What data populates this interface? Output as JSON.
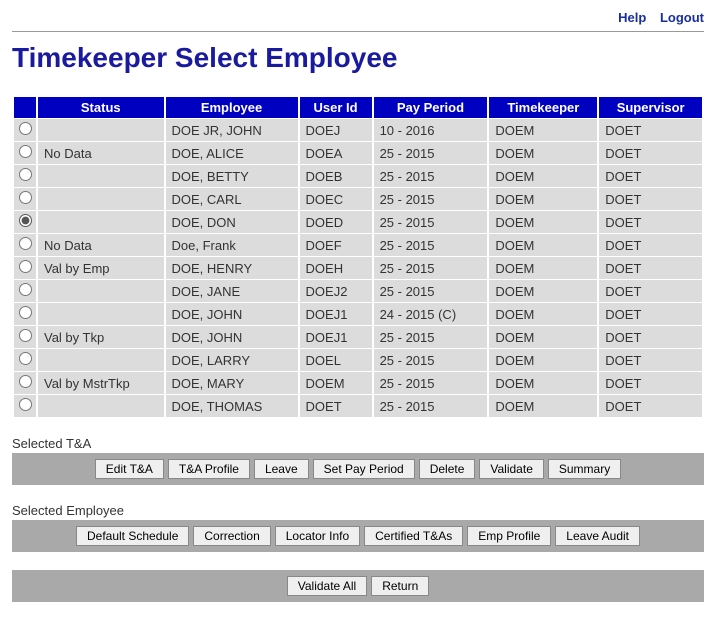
{
  "top_links": {
    "help": "Help",
    "logout": "Logout"
  },
  "page_title": "Timekeeper Select Employee",
  "columns": {
    "status": "Status",
    "employee": "Employee",
    "user_id": "User Id",
    "pay_period": "Pay Period",
    "timekeeper": "Timekeeper",
    "supervisor": "Supervisor"
  },
  "selected_index": 4,
  "rows": [
    {
      "status": "",
      "employee": "DOE JR, JOHN",
      "user_id": "DOEJ",
      "pay_period": "10 - 2016",
      "timekeeper": "DOEM",
      "supervisor": "DOET"
    },
    {
      "status": "No Data",
      "employee": "DOE, ALICE",
      "user_id": "DOEA",
      "pay_period": "25 - 2015",
      "timekeeper": "DOEM",
      "supervisor": "DOET"
    },
    {
      "status": "",
      "employee": "DOE, BETTY",
      "user_id": "DOEB",
      "pay_period": "25 - 2015",
      "timekeeper": "DOEM",
      "supervisor": "DOET"
    },
    {
      "status": "",
      "employee": "DOE, CARL",
      "user_id": "DOEC",
      "pay_period": "25 - 2015",
      "timekeeper": "DOEM",
      "supervisor": "DOET"
    },
    {
      "status": "",
      "employee": "DOE, DON",
      "user_id": "DOED",
      "pay_period": "25 - 2015",
      "timekeeper": "DOEM",
      "supervisor": "DOET"
    },
    {
      "status": "No Data",
      "employee": "Doe, Frank",
      "user_id": "DOEF",
      "pay_period": "25 - 2015",
      "timekeeper": "DOEM",
      "supervisor": "DOET"
    },
    {
      "status": "Val by Emp",
      "employee": "DOE, HENRY",
      "user_id": "DOEH",
      "pay_period": "25 - 2015",
      "timekeeper": "DOEM",
      "supervisor": "DOET"
    },
    {
      "status": "",
      "employee": "DOE, JANE",
      "user_id": "DOEJ2",
      "pay_period": "25 - 2015",
      "timekeeper": "DOEM",
      "supervisor": "DOET"
    },
    {
      "status": "",
      "employee": "DOE, JOHN",
      "user_id": "DOEJ1",
      "pay_period": "24 - 2015 (C)",
      "timekeeper": "DOEM",
      "supervisor": "DOET"
    },
    {
      "status": "Val by Tkp",
      "employee": "DOE, JOHN",
      "user_id": "DOEJ1",
      "pay_period": "25 - 2015",
      "timekeeper": "DOEM",
      "supervisor": "DOET"
    },
    {
      "status": "",
      "employee": "DOE, LARRY",
      "user_id": "DOEL",
      "pay_period": "25 - 2015",
      "timekeeper": "DOEM",
      "supervisor": "DOET"
    },
    {
      "status": "Val by MstrTkp",
      "employee": "DOE, MARY",
      "user_id": "DOEM",
      "pay_period": "25 - 2015",
      "timekeeper": "DOEM",
      "supervisor": "DOET"
    },
    {
      "status": "",
      "employee": "DOE, THOMAS",
      "user_id": "DOET",
      "pay_period": "25 - 2015",
      "timekeeper": "DOEM",
      "supervisor": "DOET"
    }
  ],
  "sections": {
    "ta_label": "Selected T&A",
    "ta_buttons": [
      "Edit T&A",
      "T&A Profile",
      "Leave",
      "Set Pay Period",
      "Delete",
      "Validate",
      "Summary"
    ],
    "emp_label": "Selected Employee",
    "emp_buttons": [
      "Default Schedule",
      "Correction",
      "Locator Info",
      "Certified T&As",
      "Emp Profile",
      "Leave Audit"
    ],
    "bottom_buttons": [
      "Validate All",
      "Return"
    ]
  }
}
